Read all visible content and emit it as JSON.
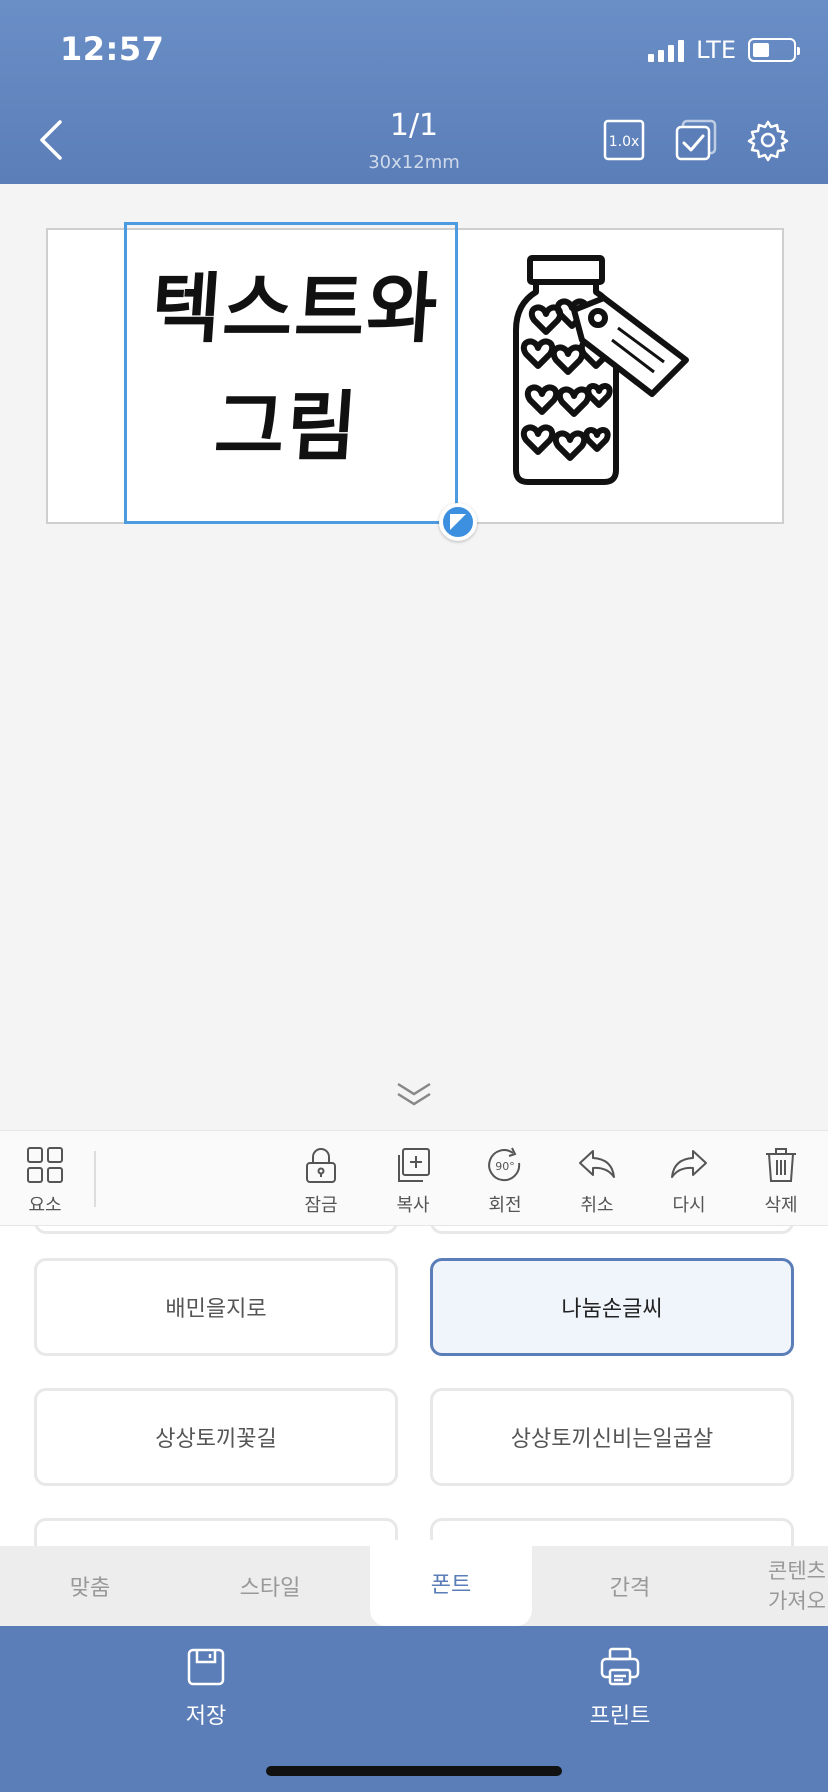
{
  "status_bar": {
    "time": "12:57",
    "network": "LTE"
  },
  "header": {
    "page_indicator": "1/1",
    "label_size": "30x12mm",
    "zoom": "1.0x"
  },
  "label": {
    "text_line1": "텍스트와",
    "text_line2": "그림",
    "image_icon": "heart-jar-icon"
  },
  "toolbar": {
    "elements": "요소",
    "lock": "잠금",
    "copy": "복사",
    "rotate": "회전",
    "rotate_badge": "90°",
    "undo": "취소",
    "redo": "다시",
    "delete": "삭제"
  },
  "fonts": {
    "options": [
      "배민을지로",
      "나눔손글씨",
      "상상토끼꽃길",
      "상상토끼신비는일곱살"
    ],
    "selected": "나눔손글씨"
  },
  "tabs": {
    "fit": "맞춤",
    "style": "스타일",
    "font": "폰트",
    "spacing": "간격",
    "import_line1": "콘텐츠",
    "import_line2": "가져오"
  },
  "tabs_active": "폰트",
  "bottom": {
    "save": "저장",
    "print": "프린트"
  },
  "colors": {
    "primary": "#5b7eb8",
    "selection": "#4c9be0",
    "background": "#f4f4f4"
  }
}
